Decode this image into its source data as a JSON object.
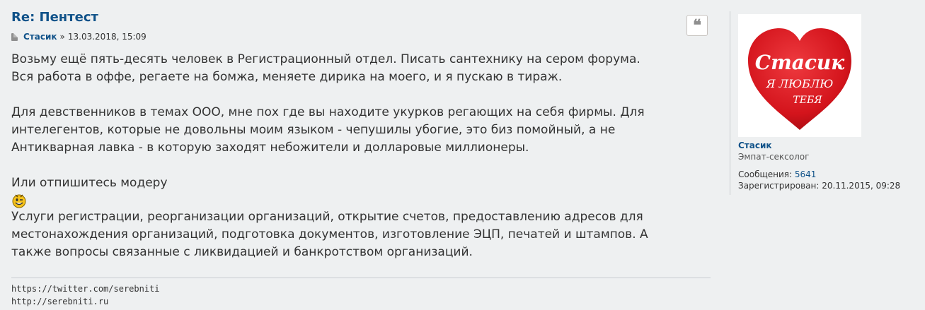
{
  "post": {
    "title": "Re: Пентест",
    "author": "Стасик",
    "separator": "»",
    "date": "13.03.2018, 15:09",
    "quote_icon": "quote-icon",
    "paragraphs": [
      "Возьму ещё пять-десять человек в Регистрационный отдел. Писать сантехнику на сером форума.",
      "Вся работа в оффе, регаете на бомжа, меняете дирика на моего, и я пускаю в тираж.",
      "Для девственников в темах ООО, мне пох где вы находите укурков регающих на себя фирмы. Для",
      "интелегентов, которые не довольны моим языком - чепушилы убогие, это биз помойный, а не",
      "Антикварная лавка - в которую заходят небожители и долларовые миллионеры.",
      "Или отпишитесь модеру",
      "Услуги регистрации, реорганизации организаций, открытие счетов, предоставлению адресов для",
      "местонахождения организаций, подготовка документов, изготовление ЭЦП, печатей и штампов. А",
      "также вопросы связанные с ликвидацией и банкротством организаций."
    ],
    "smiley_icon": "wink-smiley-icon",
    "signature": [
      "https://twitter.com/serebniti",
      "http://serebniti.ru"
    ]
  },
  "profile": {
    "avatar": {
      "line1": "Стасик",
      "line2": "Я ЛЮБЛЮ",
      "line3": "ТЕБЯ",
      "color": "#d9151d"
    },
    "name": "Стасик",
    "rank": "Эмпат-сексолог",
    "posts_label": "Сообщения:",
    "posts_value": "5641",
    "registered_label": "Зарегистрирован:",
    "registered_value": "20.11.2015, 09:28"
  },
  "colors": {
    "link": "#105289",
    "background": "#eef0f1",
    "text": "#333333"
  }
}
